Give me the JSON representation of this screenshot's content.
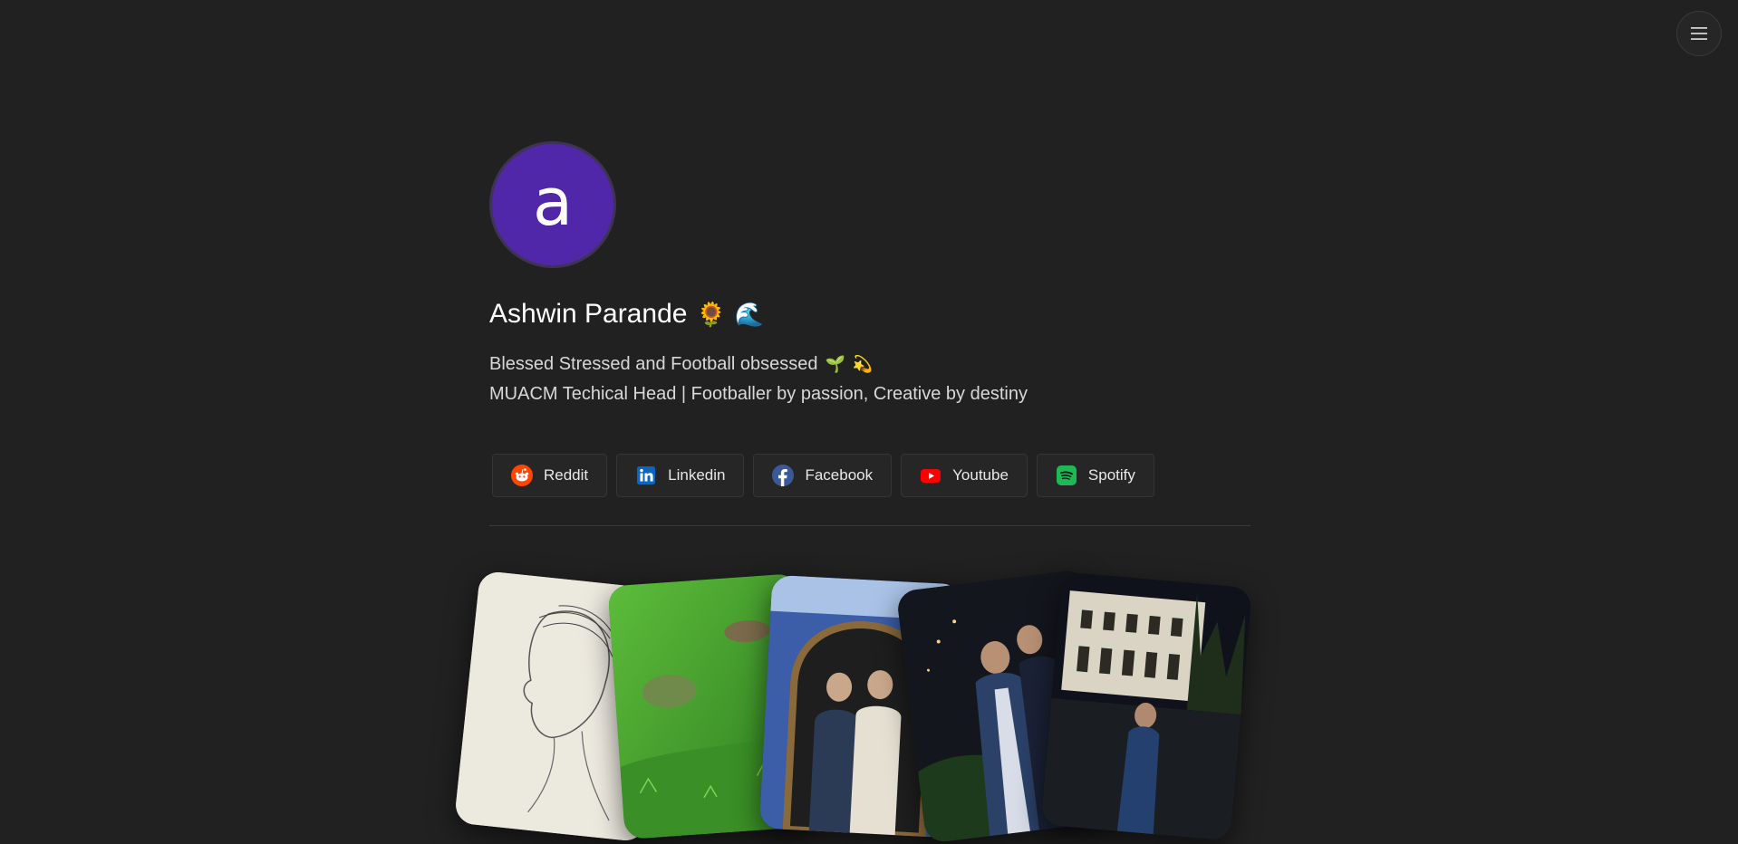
{
  "menu": {
    "icon": "hamburger-menu-icon"
  },
  "profile": {
    "avatar_letter": "a",
    "avatar_color": "#5027a8",
    "name": "Ashwin Parande",
    "name_emojis": [
      "🌻",
      "🌊"
    ],
    "bio_line1": "Blessed Stressed and Football obsessed",
    "bio_line1_emojis": [
      "🌱",
      "💫"
    ],
    "bio_line2": "MUACM Techical Head | Footballer by passion, Creative by destiny"
  },
  "links": [
    {
      "label": "Reddit",
      "icon": "reddit-icon",
      "color": "#ff4500"
    },
    {
      "label": "Linkedin",
      "icon": "linkedin-icon",
      "color": "#0a66c2"
    },
    {
      "label": "Facebook",
      "icon": "facebook-icon",
      "color": "#3b5998"
    },
    {
      "label": "Youtube",
      "icon": "youtube-icon",
      "color": "#ff0000"
    },
    {
      "label": "Spotify",
      "icon": "spotify-icon",
      "color": "#1db954"
    }
  ],
  "gallery": {
    "photos": [
      "sketch-portrait-photo",
      "green-landscape-photo",
      "mirror-selfie-photo",
      "night-friends-photo",
      "night-building-photo"
    ]
  }
}
